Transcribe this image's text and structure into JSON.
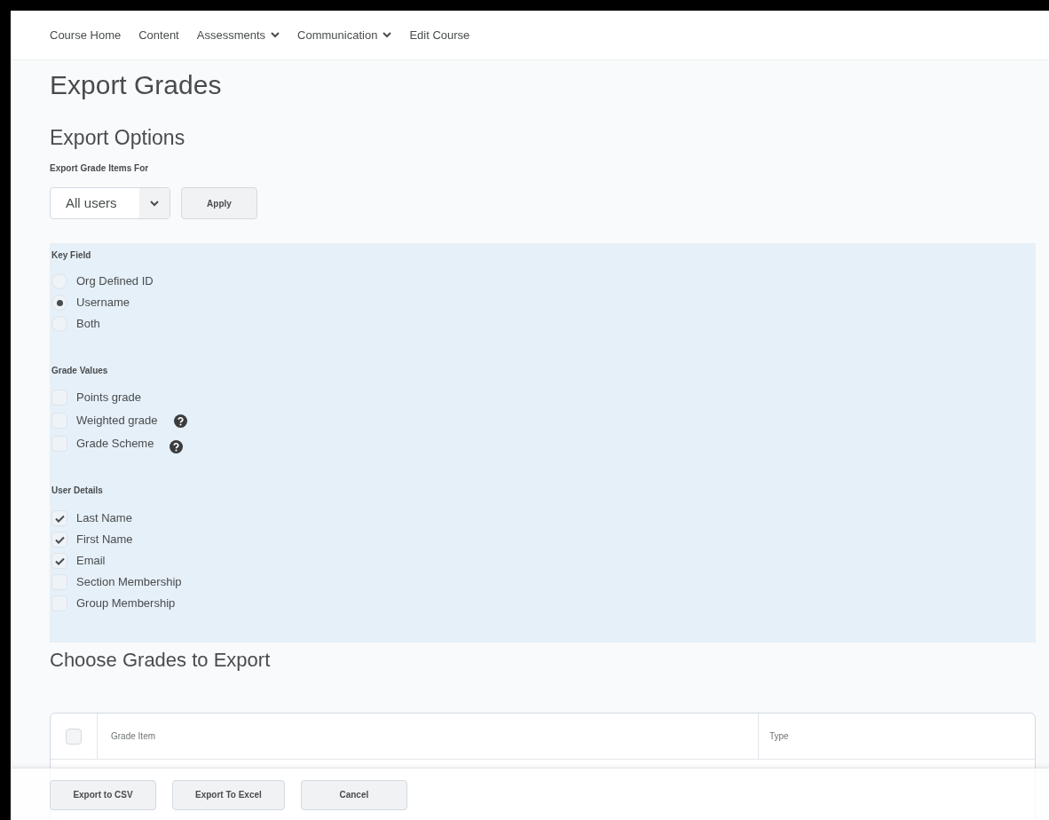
{
  "nav": [
    {
      "label": "Course Home",
      "dropdown": false
    },
    {
      "label": "Content",
      "dropdown": false
    },
    {
      "label": "Assessments",
      "dropdown": true
    },
    {
      "label": "Communication",
      "dropdown": true
    },
    {
      "label": "Edit Course",
      "dropdown": false
    }
  ],
  "page_title": "Export Grades",
  "export_options": {
    "title": "Export Options",
    "users_label": "Export Grade Items For",
    "users_select": "All users",
    "apply_button": "Apply"
  },
  "key_field": {
    "label": "Key Field",
    "options": [
      {
        "label": "Org Defined ID",
        "selected": false
      },
      {
        "label": "Username",
        "selected": true
      },
      {
        "label": "Both",
        "selected": false
      }
    ]
  },
  "grade_values": {
    "label": "Grade Values",
    "items": [
      {
        "label": "Points grade",
        "checked": false,
        "help": false
      },
      {
        "label": "Weighted grade",
        "checked": false,
        "help": true
      },
      {
        "label": "Grade Scheme",
        "checked": false,
        "help": true
      }
    ]
  },
  "user_details": {
    "label": "User Details",
    "items": [
      {
        "label": "Last Name",
        "checked": true
      },
      {
        "label": "First Name",
        "checked": true
      },
      {
        "label": "Email",
        "checked": true
      },
      {
        "label": "Section Membership",
        "checked": false
      },
      {
        "label": "Group Membership",
        "checked": false
      }
    ]
  },
  "choose_grades": {
    "title": "Choose Grades to Export",
    "columns": [
      "Grade Item",
      "Type"
    ],
    "select_all_checked": false
  },
  "footer_buttons": [
    "Export to CSV",
    "Export To Excel",
    "Cancel"
  ]
}
